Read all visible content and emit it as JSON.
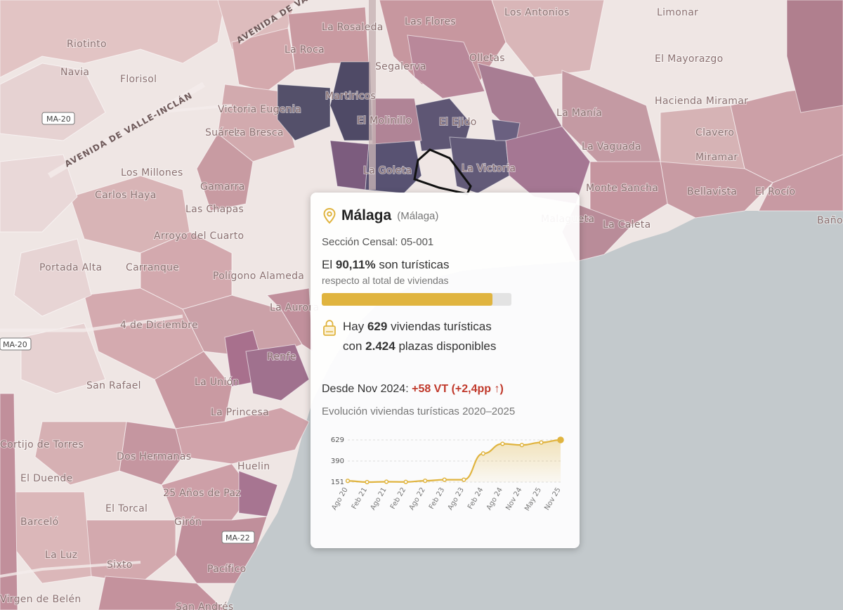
{
  "map": {
    "neighborhoods": [
      "La Rosaleda",
      "Las Flores",
      "Los Antonios",
      "Limonar",
      "Riotinto",
      "La Roca",
      "Segalerva",
      "Olletas",
      "El Mayorazgo",
      "Navia",
      "Florisol",
      "Martiricos",
      "Victoria Eugenia",
      "Hacienda Miramar",
      "El Molinillo",
      "El Ejido",
      "La Manía",
      "Suárez",
      "La Bresca",
      "Clavero",
      "La Vaguada",
      "Miramar",
      "Los Millones",
      "La Goleta",
      "La Victoria",
      "Carlos Haya",
      "Gamarra",
      "Monte Sancha",
      "Bellavista",
      "El Rocío",
      "Las Chapas",
      "La Caleta",
      "Arroyo del Cuarto",
      "Portada Alta",
      "Carranque",
      "Polígono Alameda",
      "La Aurora",
      "4 de Diciembre",
      "Renfe",
      "La Unión",
      "San Rafael",
      "La Princesa",
      "Cortijo de Torres",
      "Dos Hermanas",
      "Huelin",
      "El Duende",
      "25 Años de Paz",
      "El Torcal",
      "Barceló",
      "Girón",
      "La Luz",
      "Sixto",
      "Pacífico",
      "Virgen de Belén",
      "San Andrés",
      "Baños",
      "Malagueta"
    ],
    "streets": [
      "AVENIDA DE VALLE-INCLÁN",
      "AVENIDA DE VALLE-INCLÁN"
    ],
    "roads": [
      "MA-20",
      "MA-20",
      "MA-22"
    ]
  },
  "popup": {
    "icon": "map-pin-icon",
    "city": "Málaga",
    "province": "(Málaga)",
    "section_label": "Sección Censal: 05-001",
    "pct_prefix": "El",
    "pct_value": "90,11%",
    "pct_suffix": "son turísticas",
    "pct_sub": "respecto al total de viviendas",
    "pct_fraction": 0.9011,
    "homes_prefix": "Hay",
    "homes_count": "629",
    "homes_mid": "viviendas turísticas",
    "places_prefix": "con",
    "places_count": "2.424",
    "places_suffix": "plazas disponibles",
    "since_label": "Desde Nov 2024:",
    "since_delta": "+58 VT (+2,4pp ↑)",
    "evo_title": "Evolución viviendas turísticas 2020–2025",
    "colors": {
      "accent": "#e0b43f",
      "delta": "#c0392b"
    }
  },
  "chart_data": {
    "type": "area",
    "x": [
      "Ago 20",
      "Feb 21",
      "Ago 21",
      "Feb 22",
      "Ago 22",
      "Feb 23",
      "Ago 23",
      "Feb 24",
      "Ago 24",
      "Nov 24",
      "May 25",
      "Nov 25"
    ],
    "values": [
      165,
      151,
      155,
      153,
      166,
      178,
      178,
      475,
      585,
      571,
      600,
      629
    ],
    "yticks": [
      151,
      390,
      629
    ],
    "ylim": [
      151,
      629
    ]
  }
}
